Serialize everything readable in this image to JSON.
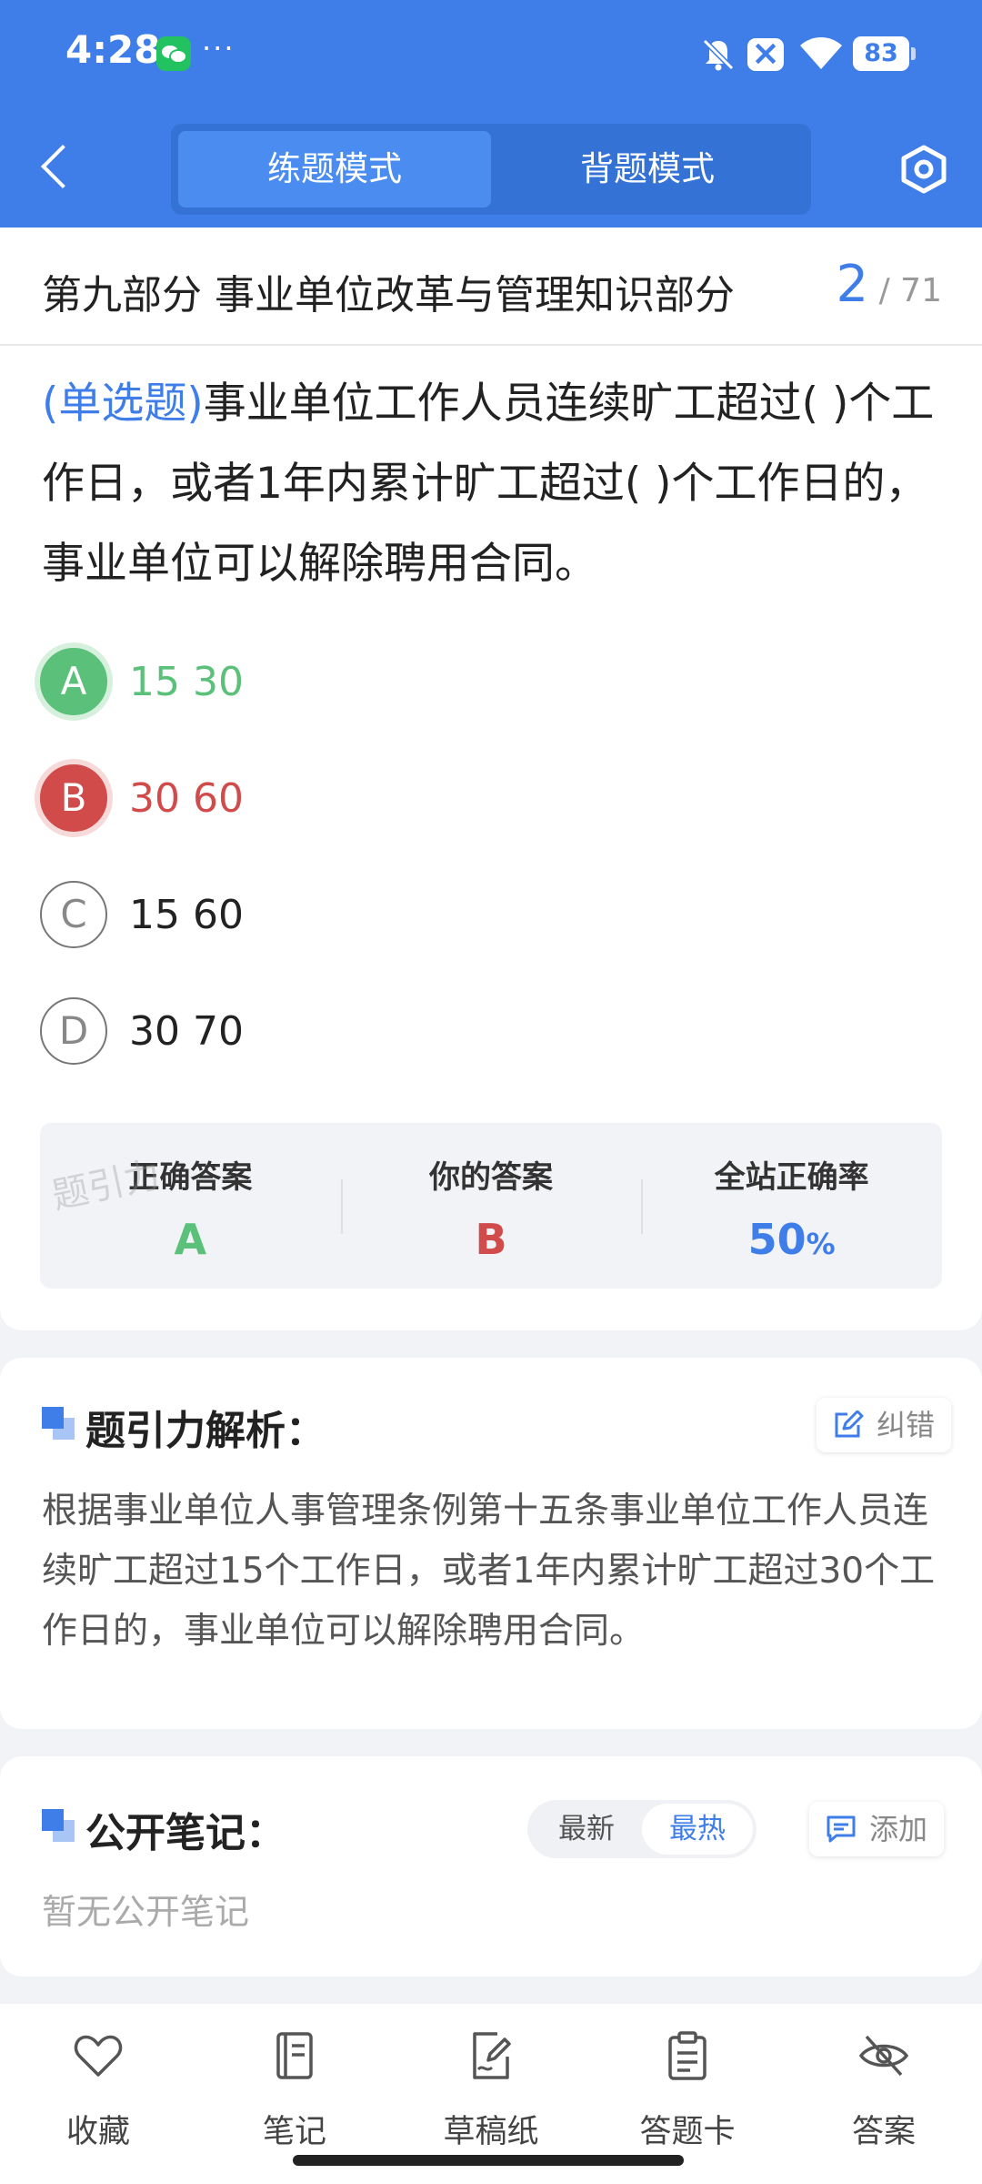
{
  "status_bar": {
    "time": "4:28",
    "more": "···",
    "battery": "83"
  },
  "header": {
    "tabs": [
      {
        "label": "练题模式",
        "active": true
      },
      {
        "label": "背题模式",
        "active": false
      }
    ]
  },
  "section": {
    "title": "第九部分 事业单位改革与管理知识部分",
    "current": "2",
    "total": "/ 71"
  },
  "question": {
    "type": "(单选题)",
    "text": "事业单位工作人员连续旷工超过(        )个工作日，或者1年内累计旷工超过(        )个工作日的，事业单位可以解除聘用合同。"
  },
  "options": [
    {
      "letter": "A",
      "text": "15 30",
      "state": "correct"
    },
    {
      "letter": "B",
      "text": "30 60",
      "state": "wrong"
    },
    {
      "letter": "C",
      "text": "15 60",
      "state": "normal"
    },
    {
      "letter": "D",
      "text": "30 70",
      "state": "normal"
    }
  ],
  "answer_summary": {
    "correct_label": "正确答案",
    "correct_value": "A",
    "yours_label": "你的答案",
    "yours_value": "B",
    "rate_label": "全站正确率",
    "rate_value": "50",
    "rate_unit": "%",
    "watermark": "题引力"
  },
  "analysis": {
    "title": "题引力解析：",
    "correct_button": "纠错",
    "text": "根据事业单位人事管理条例第十五条事业单位工作人员连续旷工超过15个工作日，或者1年内累计旷工超过30个工作日的，事业单位可以解除聘用合同。"
  },
  "notes": {
    "title": "公开笔记：",
    "sort_latest": "最新",
    "sort_hot": "最热",
    "add_button": "添加",
    "empty_text": "暂无公开笔记"
  },
  "toolbar": {
    "items": [
      {
        "label": "收藏",
        "icon": "heart-icon"
      },
      {
        "label": "笔记",
        "icon": "notebook-icon"
      },
      {
        "label": "草稿纸",
        "icon": "draft-icon"
      },
      {
        "label": "答题卡",
        "icon": "clipboard-icon"
      },
      {
        "label": "答案",
        "icon": "eye-off-icon"
      }
    ]
  },
  "colors": {
    "primary": "#3f7ee8",
    "correct": "#5bc07a",
    "wrong": "#d14b4b"
  }
}
